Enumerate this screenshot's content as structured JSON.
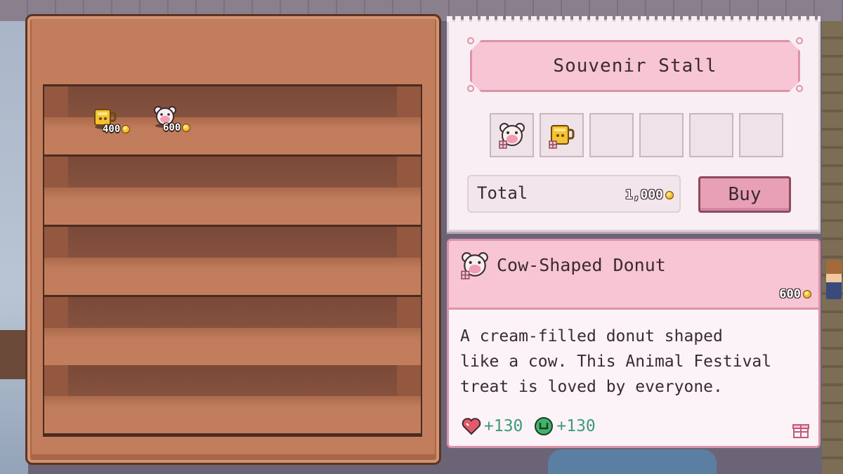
{
  "shelf": {
    "items": [
      {
        "name": "mug",
        "icon": "mug-icon",
        "price": "400"
      },
      {
        "name": "cow-donut",
        "icon": "cow-donut-icon",
        "price": "600"
      }
    ]
  },
  "stall": {
    "title": "Souvenir Stall",
    "slots": [
      {
        "icon": "cow-donut-icon"
      },
      {
        "icon": "mug-icon"
      },
      {
        "icon": ""
      },
      {
        "icon": ""
      },
      {
        "icon": ""
      },
      {
        "icon": ""
      }
    ],
    "total_label": "Total",
    "total_value": "1,000",
    "buy_label": "Buy"
  },
  "detail": {
    "name": "Cow-Shaped Donut",
    "price": "600",
    "description_lines": [
      "A cream-filled donut shaped",
      "like a cow. This Animal Festival",
      "treat is loved by everyone."
    ],
    "stats": [
      {
        "icon": "heart-icon",
        "value": "+130"
      },
      {
        "icon": "stamina-icon",
        "value": "+130"
      }
    ],
    "gift_icon": "gift-icon"
  },
  "colors": {
    "cabinet_wood": "#c27e5c",
    "panel_pink": "#f7c5d3",
    "panel_border": "#dc93aa",
    "stat_green": "#3d9a7a",
    "coin_gold": "#f4c232"
  }
}
